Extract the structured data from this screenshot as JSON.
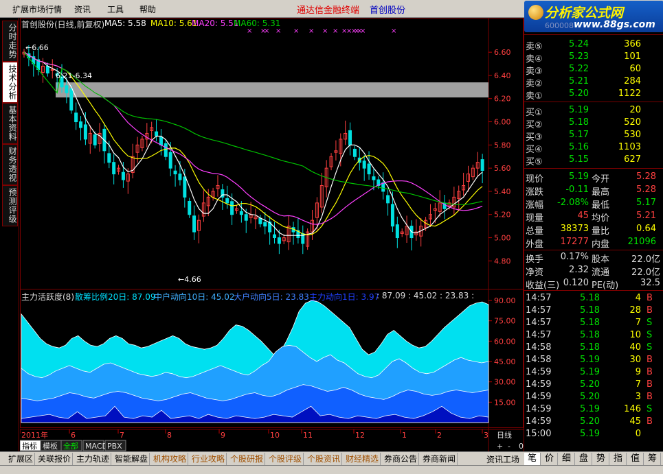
{
  "menu": {
    "items": [
      "扩展市场行情",
      "资讯",
      "工具",
      "帮助"
    ],
    "app_title": "通达信金融终端",
    "stock_name_title": "首创股份"
  },
  "logo": {
    "main": "分析家公式网",
    "url": "www.88gs.com"
  },
  "left_tabs": [
    "分时走势",
    "技术分析",
    "基本资料",
    "财务透视",
    "预测评级"
  ],
  "kline_header": {
    "name": "首创股份(日线,前复权)",
    "ma5": "MA5: 5.58",
    "ma10": "MA10: 5.61",
    "ma20": "MA20: 5.51",
    "ma60": "MA60: 5.31"
  },
  "annotations": {
    "high_left": "6.66",
    "range": "6.21-6.34",
    "low": "4.66"
  },
  "indicator_header": {
    "name": "主力活跃度(8)",
    "s1": "散筹比例20日: 87.09",
    "s2": "中户动向10日: 45.02",
    "s3": "大户动向5日: 23.83",
    "s4": "主力动向1日: 3.97",
    "tail": ": 87.09 : 45.02 : 23.83 :"
  },
  "price_ticks": [
    "6.60",
    "6.40",
    "6.20",
    "6.00",
    "5.80",
    "5.60",
    "5.40",
    "5.20",
    "5.00",
    "4.80"
  ],
  "ind_ticks": [
    "90.00",
    "75.00",
    "60.00",
    "45.00",
    "30.00",
    "15.00"
  ],
  "date_axis": [
    "2011年",
    "6",
    "7",
    "8",
    "9",
    "10",
    "11",
    "12",
    "1",
    "2",
    "3"
  ],
  "period_label": "日线",
  "axis_buttons": [
    "+",
    "-",
    "0"
  ],
  "quote": {
    "code_ghost": "600008",
    "asks": [
      {
        "label": "卖⑤",
        "price": "5.24",
        "vol": "366"
      },
      {
        "label": "卖④",
        "price": "5.23",
        "vol": "101"
      },
      {
        "label": "卖③",
        "price": "5.22",
        "vol": "60"
      },
      {
        "label": "卖②",
        "price": "5.21",
        "vol": "284"
      },
      {
        "label": "卖①",
        "price": "5.20",
        "vol": "1122"
      }
    ],
    "bids": [
      {
        "label": "买①",
        "price": "5.19",
        "vol": "20"
      },
      {
        "label": "买②",
        "price": "5.18",
        "vol": "520"
      },
      {
        "label": "买③",
        "price": "5.17",
        "vol": "530"
      },
      {
        "label": "买④",
        "price": "5.16",
        "vol": "1103"
      },
      {
        "label": "买⑤",
        "price": "5.15",
        "vol": "627"
      }
    ],
    "stats": [
      {
        "l1": "现价",
        "v1": "5.19",
        "l2": "今开",
        "v2": "5.28",
        "c1": "#00e000",
        "c2": "#ff4040"
      },
      {
        "l1": "涨跌",
        "v1": "-0.11",
        "l2": "最高",
        "v2": "5.28",
        "c1": "#00e000",
        "c2": "#ff4040"
      },
      {
        "l1": "涨幅",
        "v1": "-2.08%",
        "l2": "最低",
        "v2": "5.17",
        "c1": "#00e000",
        "c2": "#00e000"
      },
      {
        "l1": "现量",
        "v1": "45",
        "l2": "均价",
        "v2": "5.21",
        "c1": "#ff4040",
        "c2": "#ff4040"
      },
      {
        "l1": "总量",
        "v1": "38373",
        "l2": "量比",
        "v2": "0.64",
        "c1": "#ffff00",
        "c2": "#ffff00"
      },
      {
        "l1": "外盘",
        "v1": "17277",
        "l2": "内盘",
        "v2": "21096",
        "c1": "#ff4040",
        "c2": "#00e000"
      }
    ],
    "fund": [
      {
        "l1": "换手",
        "v1": "0.17%",
        "l2": "股本",
        "v2": "22.0亿"
      },
      {
        "l1": "净资",
        "v1": "2.32",
        "l2": "流通",
        "v2": "22.0亿"
      },
      {
        "l1": "收益(三)",
        "v1": "0.120",
        "l2": "PE(动)",
        "v2": "32.5"
      }
    ],
    "ticks": [
      {
        "t": "14:57",
        "p": "5.18",
        "v": "4",
        "d": "B",
        "pc": "#00e000",
        "dc": "#ff4040"
      },
      {
        "t": "14:57",
        "p": "5.18",
        "v": "28",
        "d": "B",
        "pc": "#00e000",
        "dc": "#ff4040"
      },
      {
        "t": "14:57",
        "p": "5.18",
        "v": "7",
        "d": "S",
        "pc": "#00e000",
        "dc": "#00e000"
      },
      {
        "t": "14:57",
        "p": "5.18",
        "v": "10",
        "d": "S",
        "pc": "#00e000",
        "dc": "#00e000"
      },
      {
        "t": "14:58",
        "p": "5.18",
        "v": "40",
        "d": "S",
        "pc": "#00e000",
        "dc": "#00e000"
      },
      {
        "t": "14:58",
        "p": "5.19",
        "v": "30",
        "d": "B",
        "pc": "#00e000",
        "dc": "#ff4040"
      },
      {
        "t": "14:59",
        "p": "5.19",
        "v": "9",
        "d": "B",
        "pc": "#00e000",
        "dc": "#ff4040"
      },
      {
        "t": "14:59",
        "p": "5.20",
        "v": "7",
        "d": "B",
        "pc": "#00e000",
        "dc": "#ff4040"
      },
      {
        "t": "14:59",
        "p": "5.20",
        "v": "3",
        "d": "B",
        "pc": "#00e000",
        "dc": "#ff4040"
      },
      {
        "t": "14:59",
        "p": "5.19",
        "v": "146",
        "d": "S",
        "pc": "#00e000",
        "dc": "#00e000"
      },
      {
        "t": "14:59",
        "p": "5.20",
        "v": "45",
        "d": "B",
        "pc": "#00e000",
        "dc": "#ff4040"
      },
      {
        "t": "15:00",
        "p": "5.19",
        "v": "0",
        "d": "",
        "pc": "#00e000",
        "dc": "#ff4040"
      }
    ]
  },
  "bottom_tabs": [
    "扩展区",
    "关联报价",
    "主力轨迹",
    "智能解盘",
    "机构攻略",
    "行业攻略",
    "个股研报",
    "个股评级",
    "个股资讯",
    "财经精选",
    "券商公告",
    "券商新闻"
  ],
  "bottom_small_tabs": [
    "指标",
    "模板",
    "全部",
    "MACD",
    "PBX"
  ],
  "right_bottom": {
    "label": "资讯工场",
    "tabs": [
      "笔",
      "价",
      "细",
      "盘",
      "势",
      "指",
      "值",
      "筹"
    ]
  },
  "colors": {
    "up": "#ff4040",
    "down": "#00e0e0",
    "ma5": "#ffffff",
    "ma10": "#ffff00",
    "ma20": "#ff40ff",
    "ma60": "#00c000",
    "frame": "#7a0000"
  },
  "chart_data": [
    {
      "type": "candlestick",
      "title": "首创股份(日线,前复权)",
      "ylim": [
        4.66,
        6.66
      ],
      "series": [
        {
          "name": "MA5",
          "last": 5.58
        },
        {
          "name": "MA10",
          "last": 5.61
        },
        {
          "name": "MA20",
          "last": 5.51
        },
        {
          "name": "MA60",
          "last": 5.31
        }
      ],
      "x": [
        "2011年",
        "6",
        "7",
        "8",
        "9",
        "10",
        "11",
        "12",
        "1",
        "2",
        "3"
      ],
      "close_path": [
        6.6,
        6.55,
        6.5,
        6.45,
        6.48,
        6.42,
        6.45,
        6.4,
        6.3,
        6.25,
        6.1,
        6.0,
        5.95,
        5.85,
        5.9,
        5.8,
        5.9,
        5.75,
        5.65,
        5.55,
        5.6,
        5.5,
        5.55,
        5.7,
        5.8,
        5.85,
        5.9,
        5.95,
        5.88,
        5.8,
        5.7,
        5.6,
        5.55,
        5.5,
        5.35,
        5.2,
        5.05,
        5.15,
        5.3,
        5.35,
        5.4,
        5.45,
        5.35,
        5.3,
        5.2,
        5.25,
        5.2,
        5.15,
        5.2,
        5.18,
        5.12,
        5.1,
        5.05,
        5.0,
        4.95,
        5.0,
        5.1,
        5.05,
        5.0,
        4.95,
        5.05,
        5.15,
        5.3,
        5.45,
        5.6,
        5.7,
        5.75,
        5.85,
        5.9,
        5.8,
        5.7,
        5.65,
        5.6,
        5.55,
        5.5,
        5.45,
        5.4,
        5.3,
        5.1,
        5.0,
        5.05,
        5.1,
        5.0,
        5.05,
        5.1,
        5.15,
        5.2,
        5.25,
        5.3,
        5.25,
        5.3,
        5.35,
        5.4,
        5.45,
        5.55,
        5.6,
        5.65,
        5.58
      ]
    },
    {
      "type": "area",
      "title": "主力活跃度(8)",
      "ylim": [
        0,
        90
      ],
      "series": [
        {
          "name": "散筹比例20日",
          "last": 87.09
        },
        {
          "name": "中户动向10日",
          "last": 45.02
        },
        {
          "name": "大户动向5日",
          "last": 23.83
        },
        {
          "name": "主力动向1日",
          "last": 3.97
        }
      ],
      "s1": [
        80,
        74,
        68,
        62,
        58,
        56,
        55,
        57,
        62,
        64,
        60,
        57,
        56,
        58,
        62,
        64,
        62,
        58,
        57,
        55,
        56,
        58,
        60,
        62,
        64,
        62,
        58,
        56,
        55,
        54,
        55,
        57,
        62,
        68,
        72,
        71,
        68,
        64,
        60,
        55,
        50,
        52,
        60,
        70,
        82,
        88,
        90,
        89,
        86,
        82,
        78,
        74,
        70,
        62,
        54,
        50,
        52,
        58,
        65,
        68,
        64,
        60,
        57,
        55,
        56,
        60,
        65,
        70,
        74,
        78,
        82,
        86,
        88,
        89,
        87
      ],
      "s2": [
        40,
        36,
        34,
        33,
        35,
        38,
        40,
        42,
        40,
        38,
        37,
        40,
        43,
        44,
        42,
        40,
        38,
        36,
        35,
        34,
        35,
        37,
        36,
        34,
        33,
        34,
        36,
        38,
        40,
        42,
        40,
        38,
        36,
        35,
        38,
        42,
        45,
        52,
        56,
        57,
        56,
        52,
        48,
        45,
        48,
        50,
        46,
        44,
        40,
        36,
        34,
        33,
        35,
        40,
        45,
        47,
        44,
        40,
        37,
        36,
        37,
        40,
        43,
        46,
        48,
        46,
        45,
        44,
        45
      ],
      "s3": [
        18,
        17,
        16,
        17,
        18,
        20,
        22,
        21,
        19,
        18,
        20,
        22,
        23,
        22,
        20,
        18,
        17,
        16,
        17,
        19,
        21,
        22,
        20,
        18,
        17,
        16,
        17,
        19,
        21,
        22,
        20,
        19,
        21,
        24,
        26,
        28,
        27,
        25,
        23,
        24,
        26,
        24,
        21,
        19,
        18,
        17,
        19,
        22,
        24,
        23,
        21,
        20,
        21,
        23,
        24,
        23,
        22,
        23,
        24
      ],
      "s4": [
        3,
        4,
        5,
        6,
        4,
        3,
        8,
        3,
        4,
        5,
        12,
        4,
        3,
        5,
        4,
        9,
        3,
        4,
        5,
        3,
        6,
        4,
        3,
        5,
        4,
        3,
        4,
        6,
        5,
        4,
        8,
        12,
        5,
        6,
        4,
        3,
        5,
        4,
        3,
        5,
        6,
        4,
        3,
        5,
        8,
        12,
        7,
        4,
        3,
        5,
        4
      ]
    }
  ]
}
